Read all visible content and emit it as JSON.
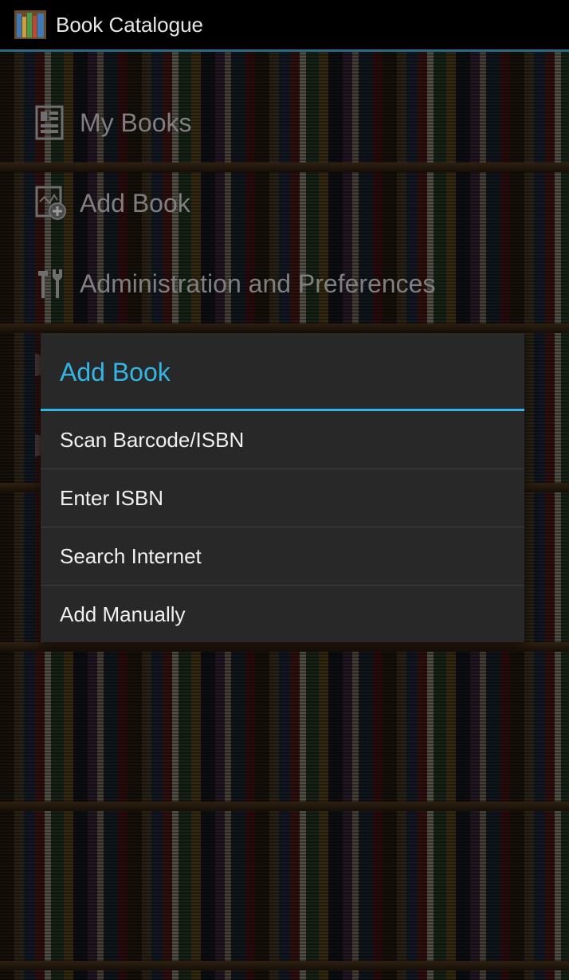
{
  "action_bar": {
    "title": "Book Catalogue",
    "icon": "bookshelf-icon",
    "accent_color": "#2f6a86"
  },
  "main_menu": {
    "items": [
      {
        "label": "My Books",
        "icon": "books-list-icon"
      },
      {
        "label": "Add Book",
        "icon": "add-book-icon"
      },
      {
        "label": "Administration and Preferences",
        "icon": "tools-icon"
      }
    ],
    "text_color": "#7f7f7f"
  },
  "dialog": {
    "title": "Add Book",
    "accent_color": "#33b5e5",
    "options": [
      {
        "label": "Scan Barcode/ISBN"
      },
      {
        "label": "Enter ISBN"
      },
      {
        "label": "Search Internet"
      },
      {
        "label": "Add Manually"
      }
    ]
  }
}
